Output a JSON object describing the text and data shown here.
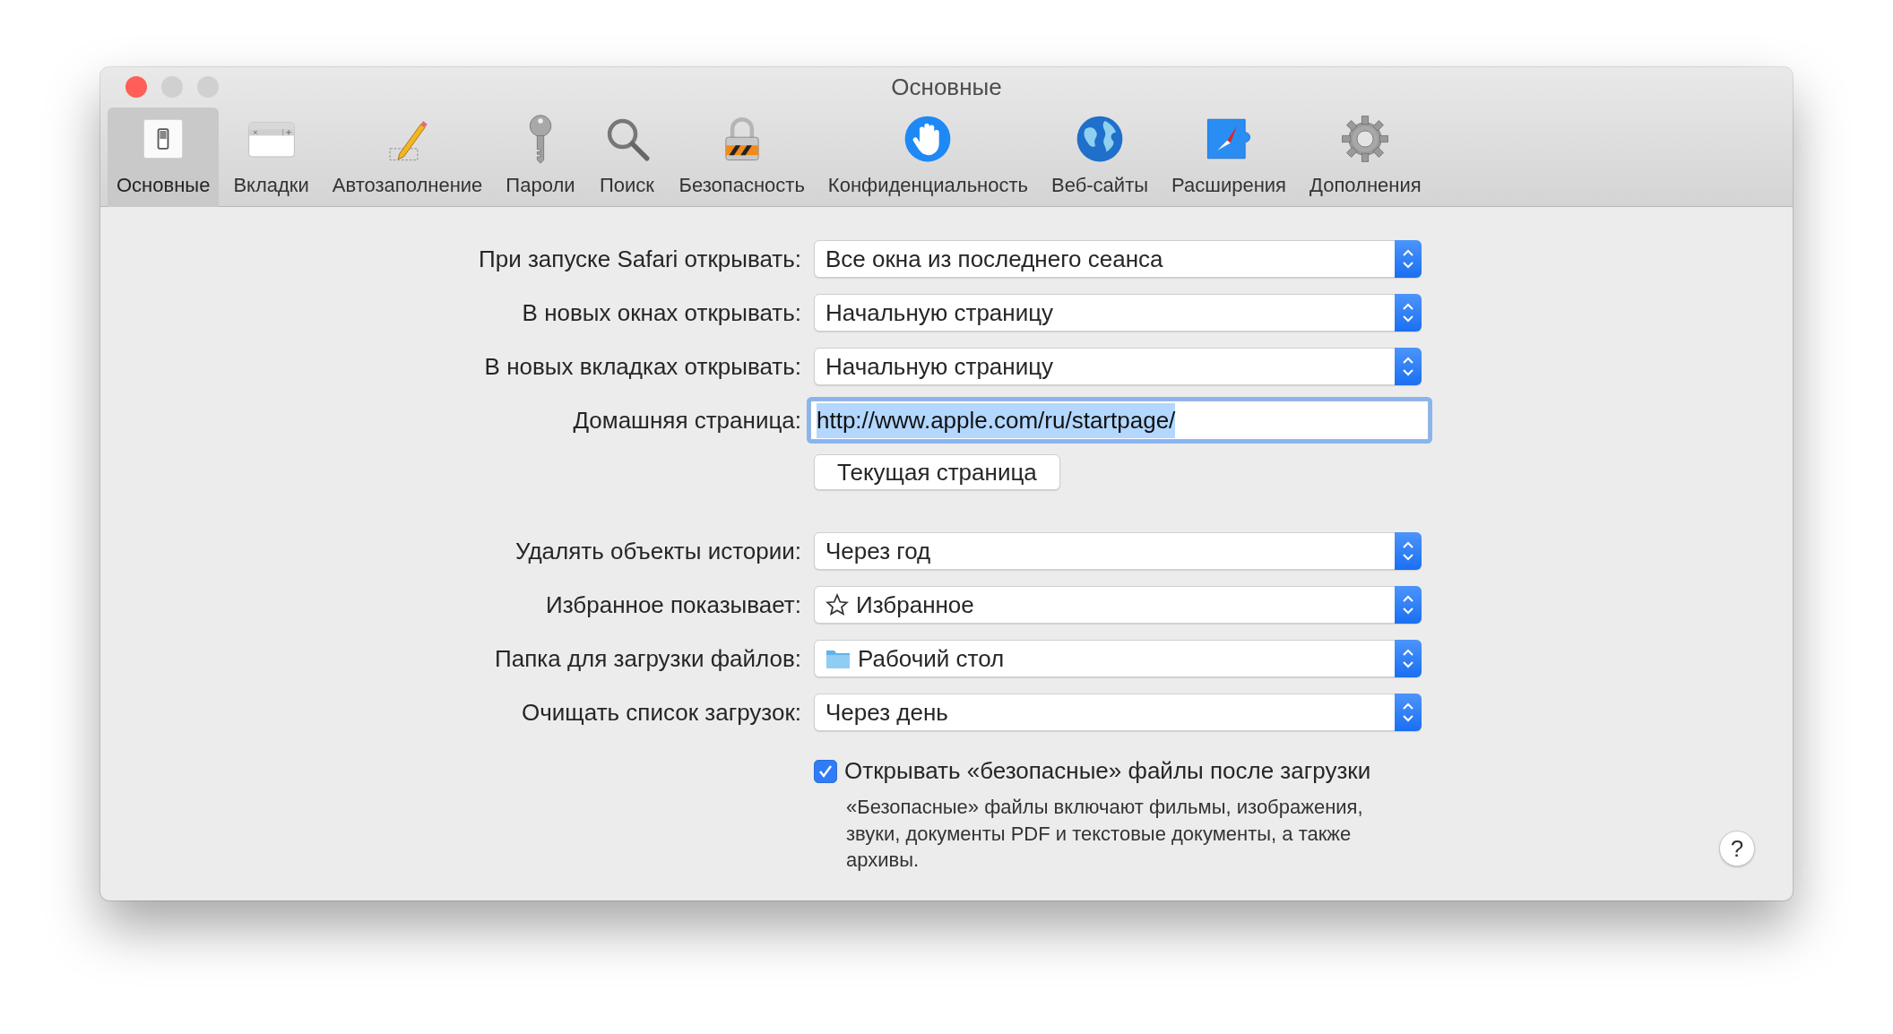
{
  "window": {
    "title": "Основные"
  },
  "toolbar": [
    {
      "label": "Основные",
      "selected": true
    },
    {
      "label": "Вкладки",
      "selected": false
    },
    {
      "label": "Автозаполнение",
      "selected": false
    },
    {
      "label": "Пароли",
      "selected": false
    },
    {
      "label": "Поиск",
      "selected": false
    },
    {
      "label": "Безопасность",
      "selected": false
    },
    {
      "label": "Конфиденциальность",
      "selected": false
    },
    {
      "label": "Веб-сайты",
      "selected": false
    },
    {
      "label": "Расширения",
      "selected": false
    },
    {
      "label": "Дополнения",
      "selected": false
    }
  ],
  "settings": [
    {
      "kind": "popup",
      "label": "При запуске Safari открывать:",
      "value": "Все окна из последнего сеанса"
    },
    {
      "kind": "popup",
      "label": "В новых окнах открывать:",
      "value": "Начальную страницу"
    },
    {
      "kind": "popup",
      "label": "В новых вкладках открывать:",
      "value": "Начальную страницу"
    },
    {
      "kind": "textfield",
      "label": "Домашняя страница:",
      "value": "http://www.apple.com/ru/startpage/",
      "focused": true,
      "text_selected": true
    },
    {
      "kind": "button",
      "label": "Текущая страница"
    },
    {
      "kind": "popup",
      "label": "Удалять объекты истории:",
      "value": "Через год"
    },
    {
      "kind": "starpopup",
      "label": "Избранное показывает:",
      "value": "Избранное"
    },
    {
      "kind": "folderpopup",
      "label": "Папка для загрузки файлов:",
      "value": "Рабочий стол"
    },
    {
      "kind": "popup",
      "label": "Очищать список загрузок:",
      "value": "Через день"
    },
    {
      "kind": "checkbox",
      "label": "Открывать «безопасные» файлы после загрузки",
      "checked": true,
      "note": "«Безопасные» файлы включают фильмы, изображения, звуки, документы PDF и текстовые документы, а также архивы."
    }
  ],
  "help_button": "?"
}
